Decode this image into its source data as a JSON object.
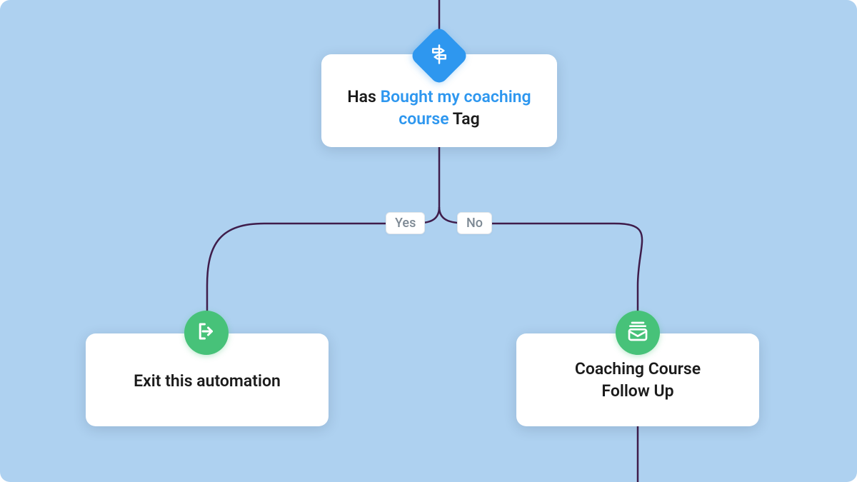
{
  "colors": {
    "background": "#AED1F0",
    "accent_blue": "#2E97EF",
    "accent_green": "#47C279",
    "connector": "#3F1D4B"
  },
  "condition": {
    "prefix": "Has ",
    "highlight": "Bought my coaching course",
    "suffix": " Tag",
    "icon": "signpost-icon"
  },
  "branches": {
    "yes_label": "Yes",
    "no_label": "No"
  },
  "yes_action": {
    "label": "Exit this automation",
    "icon": "exit-icon"
  },
  "no_action": {
    "label_line1": "Coaching Course",
    "label_line2": "Follow Up",
    "icon": "mail-stack-icon"
  }
}
